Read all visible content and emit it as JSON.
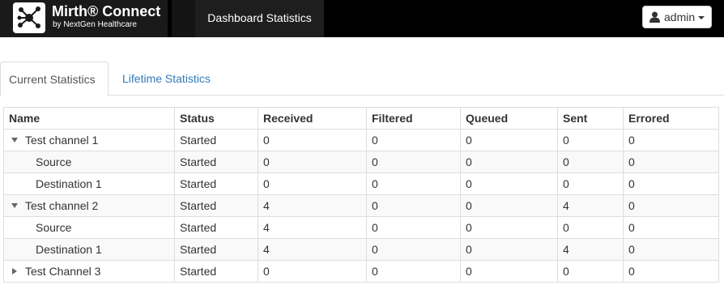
{
  "app": {
    "brand_name": "Mirth® Connect",
    "brand_sub": "by NextGen Healthcare",
    "nav_active": "Dashboard Statistics",
    "user_label": "admin"
  },
  "tabs": [
    {
      "label": "Current Statistics",
      "active": true
    },
    {
      "label": "Lifetime Statistics",
      "active": false
    }
  ],
  "table": {
    "columns": [
      "Name",
      "Status",
      "Received",
      "Filtered",
      "Queued",
      "Sent",
      "Errored"
    ],
    "rows": [
      {
        "name": "Test channel 1",
        "level": "channel",
        "expanded": true,
        "status": "Started",
        "received": "0",
        "filtered": "0",
        "queued": "0",
        "sent": "0",
        "errored": "0"
      },
      {
        "name": "Source",
        "level": "connector",
        "status": "Started",
        "received": "0",
        "filtered": "0",
        "queued": "0",
        "sent": "0",
        "errored": "0"
      },
      {
        "name": "Destination 1",
        "level": "connector",
        "status": "Started",
        "received": "0",
        "filtered": "0",
        "queued": "0",
        "sent": "0",
        "errored": "0"
      },
      {
        "name": "Test channel 2",
        "level": "channel",
        "expanded": true,
        "status": "Started",
        "received": "4",
        "filtered": "0",
        "queued": "0",
        "sent": "4",
        "errored": "0"
      },
      {
        "name": "Source",
        "level": "connector",
        "status": "Started",
        "received": "4",
        "filtered": "0",
        "queued": "0",
        "sent": "0",
        "errored": "0"
      },
      {
        "name": "Destination 1",
        "level": "connector",
        "status": "Started",
        "received": "4",
        "filtered": "0",
        "queued": "0",
        "sent": "4",
        "errored": "0"
      },
      {
        "name": "Test Channel 3",
        "level": "channel",
        "expanded": false,
        "status": "Started",
        "received": "0",
        "filtered": "0",
        "queued": "0",
        "sent": "0",
        "errored": "0"
      }
    ]
  },
  "icons": {
    "logo": "mirth-network-logo-icon",
    "user": "user-icon",
    "caret": "caret-down-icon",
    "expanded": "triangle-down-icon",
    "collapsed": "triangle-right-icon"
  },
  "colors": {
    "navbar": "#000000",
    "link": "#337ab7",
    "border": "#dddddd",
    "stripe": "#f9f9f9"
  }
}
